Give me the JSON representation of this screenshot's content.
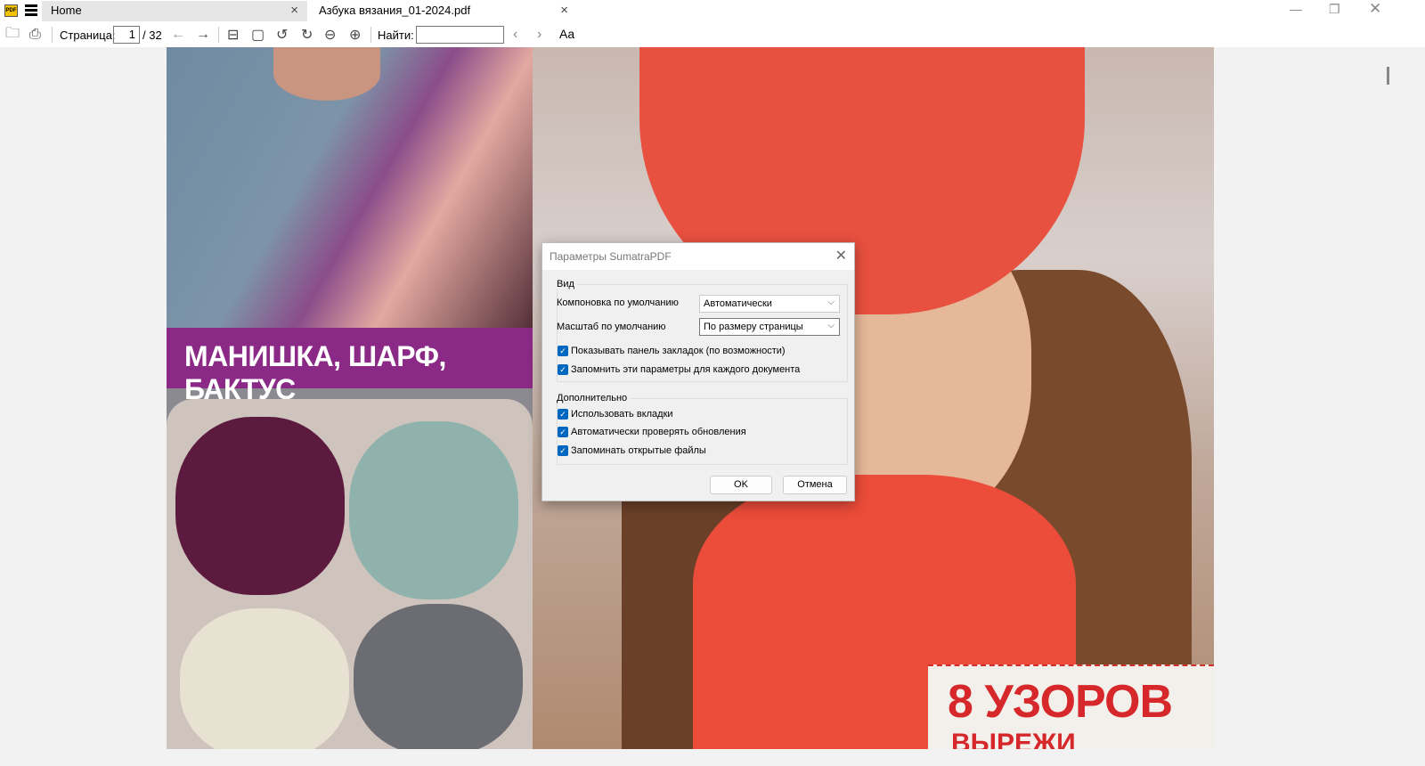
{
  "tabs": [
    {
      "label": "Home"
    },
    {
      "label": "Азбука вязания_01-2024.pdf"
    }
  ],
  "toolbar": {
    "page_label": "Страница:",
    "page_value": "1",
    "page_total": "/ 32",
    "find_label": "Найти:",
    "find_value": "",
    "match_case": "Aa"
  },
  "logo": "PDF",
  "cover": {
    "left_band": "МАНИШКА, ШАРФ, БАКТУС",
    "right_big": "8 УЗОРОВ",
    "right_small": "ВЫРЕЖИ"
  },
  "dialog": {
    "title": "Параметры SumatraPDF",
    "view_group": "Вид",
    "layout_label": "Компоновка по умолчанию",
    "layout_value": "Автоматически",
    "zoom_label": "Масштаб по умолчанию",
    "zoom_value": "По размеру страницы",
    "checks_view": [
      {
        "label": "Показывать панель закладок (по возможности)",
        "checked": true
      },
      {
        "label": "Запомнить эти параметры для каждого документа",
        "checked": true
      }
    ],
    "advanced_group": "Дополнительно",
    "checks_adv": [
      {
        "label": "Использовать вкладки",
        "checked": true
      },
      {
        "label": "Автоматически проверять обновления",
        "checked": true
      },
      {
        "label": "Запоминать открытые файлы",
        "checked": true
      }
    ],
    "ok": "OK",
    "cancel": "Отмена"
  }
}
